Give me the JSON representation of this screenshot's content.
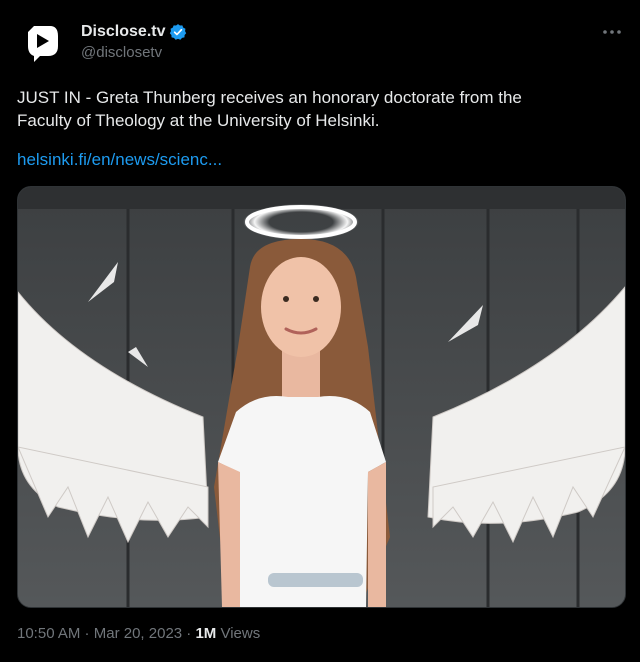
{
  "tweet": {
    "author": {
      "display_name": "Disclose.tv",
      "handle": "@disclosetv",
      "verified": true,
      "avatar_icon": "disclose-tv-logo-icon"
    },
    "more_icon": "more-horizontal-icon",
    "text": "JUST IN - Greta Thunberg receives an honorary doctorate from the\nFaculty of Theology at the University of Helsinki.",
    "link": "helsinki.fi/en/news/scienc...",
    "media": {
      "kind": "photo",
      "alt_subject": "person with halo and angel wings"
    },
    "footer": {
      "time": "10:50 AM",
      "separator1": " · ",
      "date": "Mar 20, 2023",
      "separator2": " · ",
      "views_count": "1M",
      "views_label": " Views"
    }
  },
  "colors": {
    "background": "#000000",
    "text": "#e7e9ea",
    "secondary": "#71767b",
    "link": "#1d9bf0",
    "verified": "#1d9bf0"
  }
}
